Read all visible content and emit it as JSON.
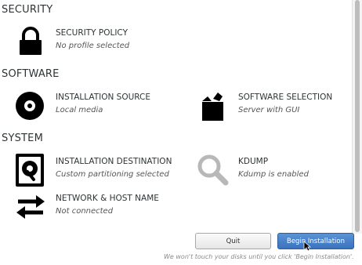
{
  "sections": {
    "security": "SECURITY",
    "software": "SOFTWARE",
    "system": "SYSTEM"
  },
  "items": {
    "security_policy": {
      "title": "SECURITY POLICY",
      "status": "No profile selected",
      "icon": "lock-icon"
    },
    "installation_source": {
      "title": "INSTALLATION SOURCE",
      "status": "Local media",
      "icon": "disc-icon"
    },
    "software_selection": {
      "title": "SOFTWARE SELECTION",
      "status": "Server with GUI",
      "icon": "package-icon"
    },
    "installation_destination": {
      "title": "INSTALLATION DESTINATION",
      "status": "Custom partitioning selected",
      "icon": "harddisk-icon"
    },
    "kdump": {
      "title": "KDUMP",
      "status": "Kdump is enabled",
      "icon": "magnifier-icon"
    },
    "network": {
      "title": "NETWORK & HOST NAME",
      "status": "Not connected",
      "icon": "network-arrows-icon"
    }
  },
  "buttons": {
    "quit": "Quit",
    "begin": "Begin Installation"
  },
  "footer_note": "We won't touch your disks until you click 'Begin Installation'.",
  "colors": {
    "text": "#2e3436",
    "accent": "#3a72bd"
  }
}
